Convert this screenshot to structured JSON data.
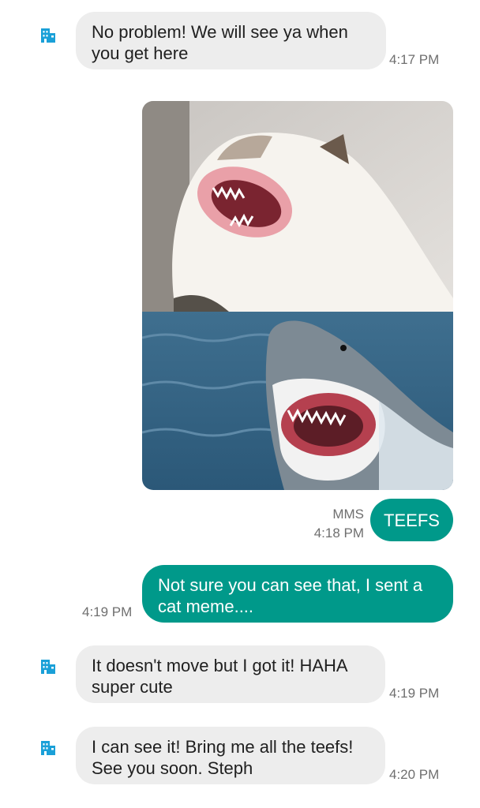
{
  "colors": {
    "outgoing_bubble": "#00998a",
    "incoming_bubble": "#ededed",
    "avatar_icon": "#1aa0d8",
    "timestamp": "#6f6f6f"
  },
  "messages": [
    {
      "direction": "incoming",
      "avatar_icon": "business-building-icon",
      "lines": [
        "No problem! We will see ya when",
        "you get here"
      ],
      "time": "4:17 PM"
    },
    {
      "direction": "outgoing",
      "type": "mms-image",
      "image_description_icons": [
        "cat-photo",
        "shark-photo"
      ],
      "text": "TEEFS",
      "label": "MMS",
      "time": "4:18 PM"
    },
    {
      "direction": "outgoing",
      "lines": [
        "Not sure you can see that, I sent a",
        "cat meme...."
      ],
      "time": "4:19 PM"
    },
    {
      "direction": "incoming",
      "avatar_icon": "business-building-icon",
      "lines": [
        "It doesn't move but I got it! HAHA",
        "super cute"
      ],
      "time": "4:19 PM"
    },
    {
      "direction": "incoming",
      "avatar_icon": "business-building-icon",
      "lines": [
        "I can see it! Bring me all the teefs!",
        "See you soon. Steph"
      ],
      "time": "4:20 PM"
    }
  ]
}
